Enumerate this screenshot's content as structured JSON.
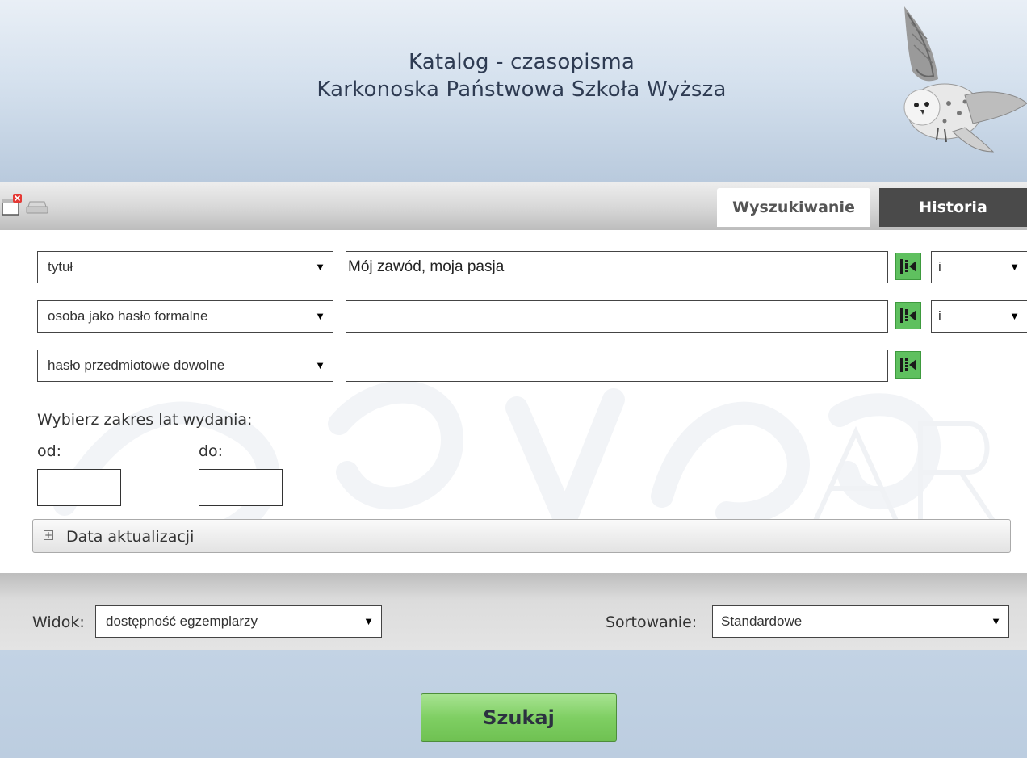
{
  "header": {
    "title_line1": "Katalog - czasopisma",
    "title_line2": "Karkonoska Państwowa Szkoła Wyższa",
    "logo_icon": "owl-icon"
  },
  "toolbar": {
    "icons": [
      "new-window-icon",
      "print-icon"
    ],
    "tabs": [
      {
        "label": "Wyszukiwanie",
        "active": true
      },
      {
        "label": "Historia",
        "active": false
      }
    ]
  },
  "search": {
    "rows": [
      {
        "field": "tytuł",
        "value": "Mój zawód, moja pasja",
        "operator": "i"
      },
      {
        "field": "osoba jako hasło formalne",
        "value": "",
        "operator": "i"
      },
      {
        "field": "hasło przedmiotowe dowolne",
        "value": ""
      }
    ],
    "year_range": {
      "label": "Wybierz zakres lat wydania:",
      "from_label": "od:",
      "to_label": "do:",
      "from_value": "",
      "to_value": ""
    },
    "update_date": {
      "label": "Data aktualizacji",
      "expanded": false
    }
  },
  "options": {
    "view_label": "Widok:",
    "view_value": "dostępność egzemplarzy",
    "sort_label": "Sortowanie:",
    "sort_value": "Standardowe"
  },
  "submit_label": "Szukaj",
  "colors": {
    "header_bg": "#d5e1ee",
    "tab_active_bg": "#ffffff",
    "tab_inactive_bg": "#4a4a4a",
    "green": "#5fc05f",
    "search_button": "#7fcf63"
  }
}
